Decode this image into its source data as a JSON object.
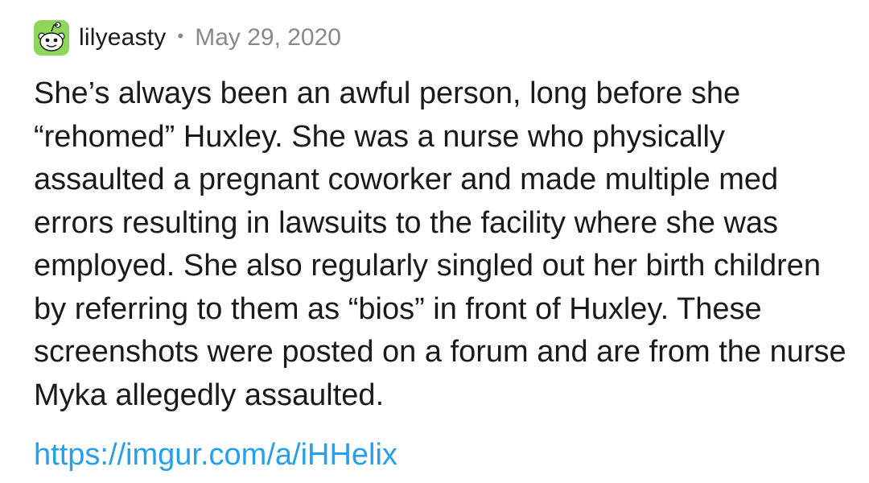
{
  "comment": {
    "author": "lilyeasty",
    "separator": "•",
    "date": "May 29, 2020",
    "avatar_icon": "snoo-avatar-icon",
    "avatar_color": "#8fd65a",
    "body": "She’s always been an awful person, long before she “rehomed” Huxley. She was a nurse who physically assaulted a pregnant coworker and made multiple med errors resulting in lawsuits to the facility where she was employed. She also regularly singled out her birth children by referring to them as “bios” in front of Huxley. These screenshots were posted on a forum and are from the nurse Myka allegedly assaulted.",
    "link_text": "https://imgur.com/a/iHHelix",
    "link_color": "#24a0ed"
  }
}
